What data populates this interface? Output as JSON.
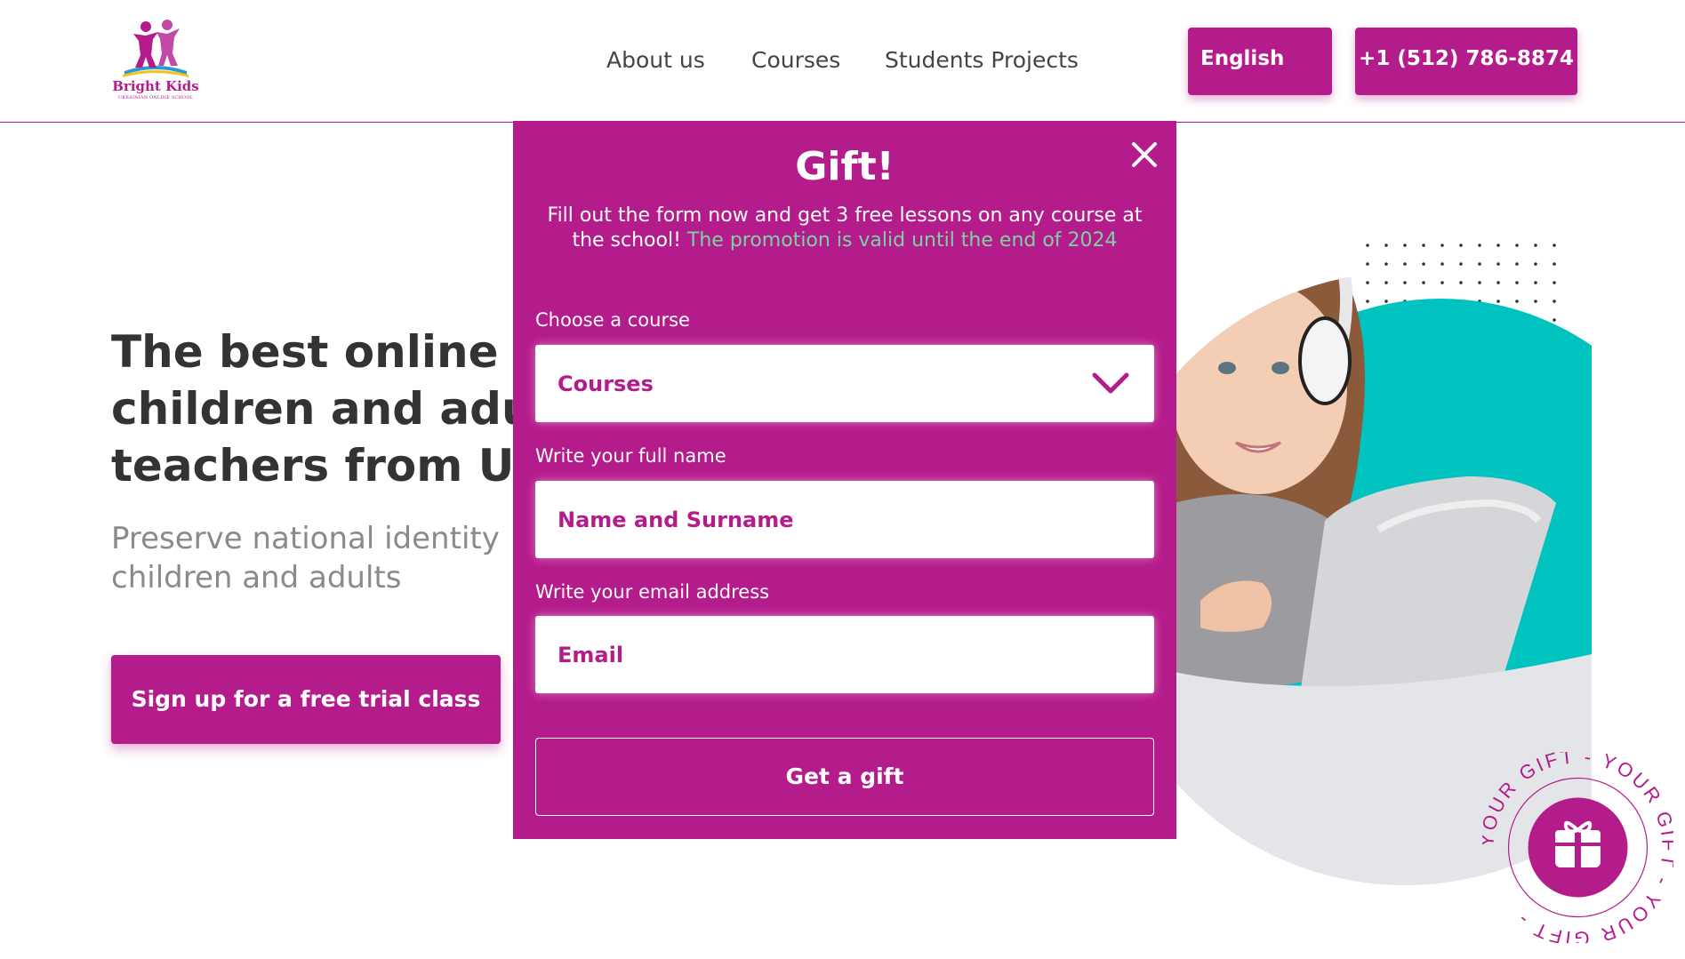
{
  "header": {
    "logo_title": "Bright Kids",
    "logo_subtitle": "UKRAINIAN ONLINE SCHOOL",
    "nav": {
      "about": "About us",
      "courses": "Courses",
      "projects": "Students Projects"
    },
    "language_button": "English",
    "phone_button": "+1 (512) 786-8874"
  },
  "hero": {
    "title_lines": [
      "The best online c",
      "children and adu",
      "teachers from Uk"
    ],
    "subtitle_lines": [
      "Preserve national identity",
      "children and adults"
    ],
    "cta_label": "Sign up for a free trial class"
  },
  "modal": {
    "title": "Gift!",
    "text_main": "Fill out the form now and get 3 free lessons on any course at the school!",
    "text_promo": "The promotion is valid until the end of 2024",
    "course_label": "Choose a course",
    "course_selected": "Courses",
    "name_label": "Write your full name",
    "name_placeholder": "Name and Surname",
    "email_label": "Write your email address",
    "email_placeholder": "Email",
    "submit_label": "Get a gift"
  },
  "badge": {
    "ring_text": "YOUR GIFT - YOUR GIFT - YOUR GIFT - "
  },
  "colors": {
    "brand": "#b51c8b",
    "teal": "#00c2bf",
    "promo": "#7ed0a5"
  },
  "icons": [
    "logo-kids-icon",
    "close-icon",
    "chevron-down-icon",
    "gift-icon"
  ]
}
